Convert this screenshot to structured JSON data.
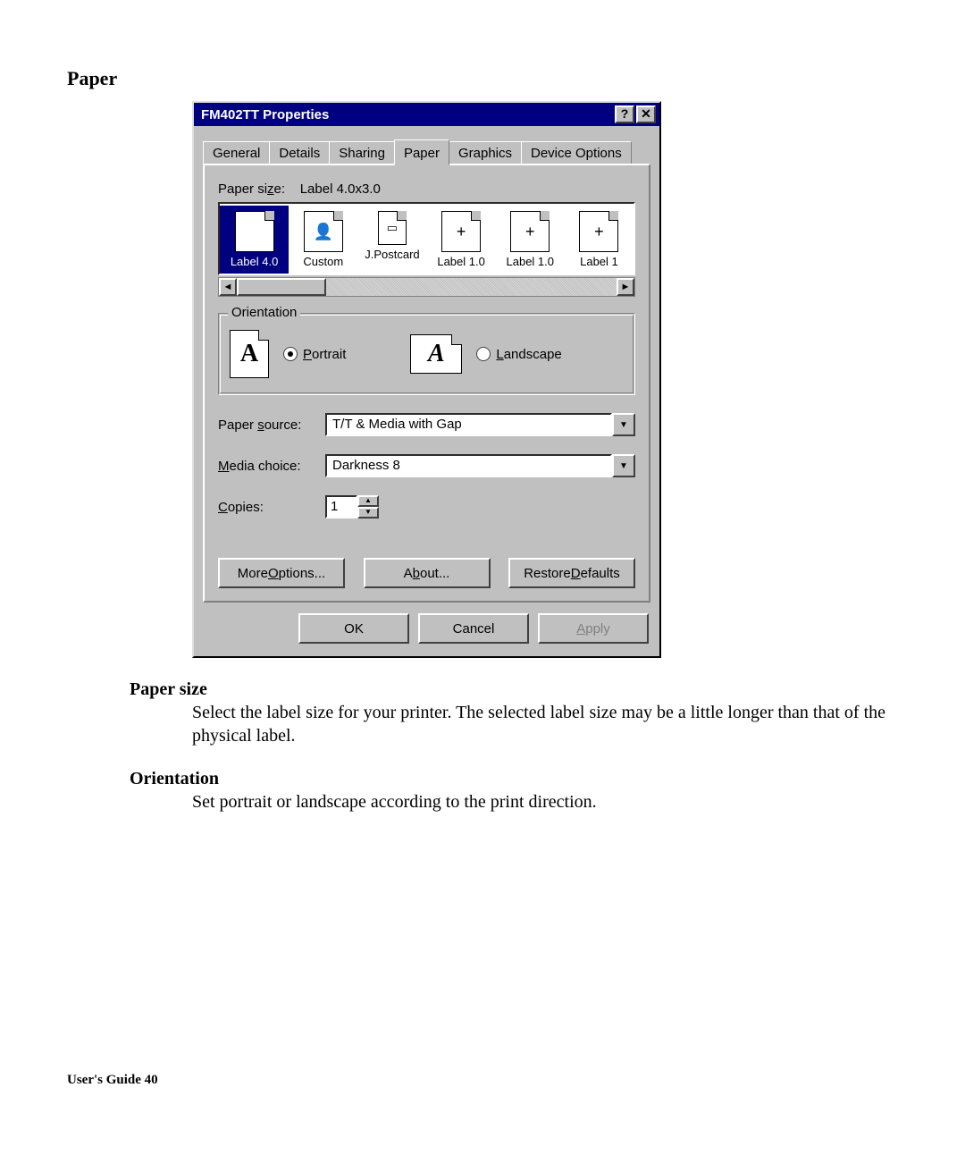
{
  "page": {
    "heading": "Paper",
    "footer": "User's Guide 40"
  },
  "dialog": {
    "title": "FM402TT Properties",
    "tabs": [
      "General",
      "Details",
      "Sharing",
      "Paper",
      "Graphics",
      "Device Options"
    ],
    "active_tab": 3,
    "paper_size_label": "Paper size:",
    "paper_size_label_ul": "z",
    "paper_size_value": "Label 4.0x3.0",
    "thumbnails": [
      {
        "label": "Label 4.0",
        "selected": true,
        "glyph": "+"
      },
      {
        "label": "Custom",
        "selected": false,
        "glyph": "👤"
      },
      {
        "label": "J.Postcard",
        "selected": false,
        "glyph": "▭"
      },
      {
        "label": "Label 1.0",
        "selected": false,
        "glyph": "+"
      },
      {
        "label": "Label 1.0",
        "selected": false,
        "glyph": "+"
      },
      {
        "label": "Label 1",
        "selected": false,
        "glyph": "+"
      }
    ],
    "orientation": {
      "legend": "Orientation",
      "portrait": "Portrait",
      "portrait_ul": "P",
      "landscape": "Landscape",
      "landscape_ul": "L",
      "value": "portrait"
    },
    "paper_source": {
      "label": "Paper source:",
      "ul": "s",
      "value": "T/T & Media with Gap"
    },
    "media_choice": {
      "label": "Media choice:",
      "ul": "M",
      "value": "Darkness 8"
    },
    "copies": {
      "label": "Copies:",
      "ul": "C",
      "value": "1"
    },
    "buttons": {
      "more_options": "More Options...",
      "more_options_ul": "O",
      "about": "About...",
      "about_ul": "b",
      "restore": "Restore Defaults",
      "restore_ul": "D",
      "ok": "OK",
      "cancel": "Cancel",
      "apply": "Apply",
      "apply_ul": "A"
    }
  },
  "doc": {
    "h1": "Paper size",
    "p1": "Select the label size for your printer.  The selected label size may be a little longer than that of the physical label.",
    "h2": "Orientation",
    "p2": "Set portrait or landscape according to the print direction."
  }
}
